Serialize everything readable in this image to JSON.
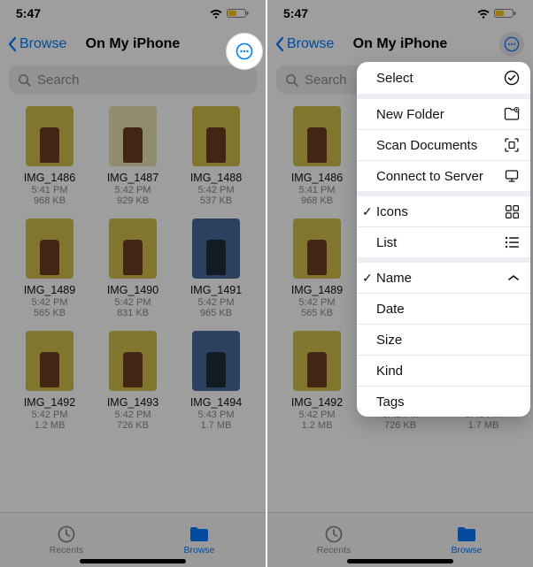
{
  "statusbar": {
    "time": "5:47"
  },
  "nav": {
    "back": "Browse",
    "title": "On My iPhone"
  },
  "search": {
    "placeholder": "Search"
  },
  "files": [
    {
      "name": "IMG_1486",
      "time": "5:41 PM",
      "size": "968 KB",
      "tone": "y"
    },
    {
      "name": "IMG_1487",
      "time": "5:42 PM",
      "size": "929 KB",
      "tone": "w"
    },
    {
      "name": "IMG_1488",
      "time": "5:42 PM",
      "size": "537 KB",
      "tone": "y"
    },
    {
      "name": "IMG_1489",
      "time": "5:42 PM",
      "size": "565 KB",
      "tone": "y"
    },
    {
      "name": "IMG_1490",
      "time": "5:42 PM",
      "size": "831 KB",
      "tone": "y"
    },
    {
      "name": "IMG_1491",
      "time": "5:42 PM",
      "size": "965 KB",
      "tone": "b"
    },
    {
      "name": "IMG_1492",
      "time": "5:42 PM",
      "size": "1.2 MB",
      "tone": "y"
    },
    {
      "name": "IMG_1493",
      "time": "5:42 PM",
      "size": "726 KB",
      "tone": "y"
    },
    {
      "name": "IMG_1494",
      "time": "5:43 PM",
      "size": "1.7 MB",
      "tone": "b"
    }
  ],
  "tabs": {
    "recents": "Recents",
    "browse": "Browse"
  },
  "menu": {
    "select": "Select",
    "new_folder": "New Folder",
    "scan_documents": "Scan Documents",
    "connect_to_server": "Connect to Server",
    "view_icons": "Icons",
    "view_list": "List",
    "sort_name": "Name",
    "sort_date": "Date",
    "sort_size": "Size",
    "sort_kind": "Kind",
    "sort_tags": "Tags",
    "current_view": "Icons",
    "current_sort": "Name"
  }
}
